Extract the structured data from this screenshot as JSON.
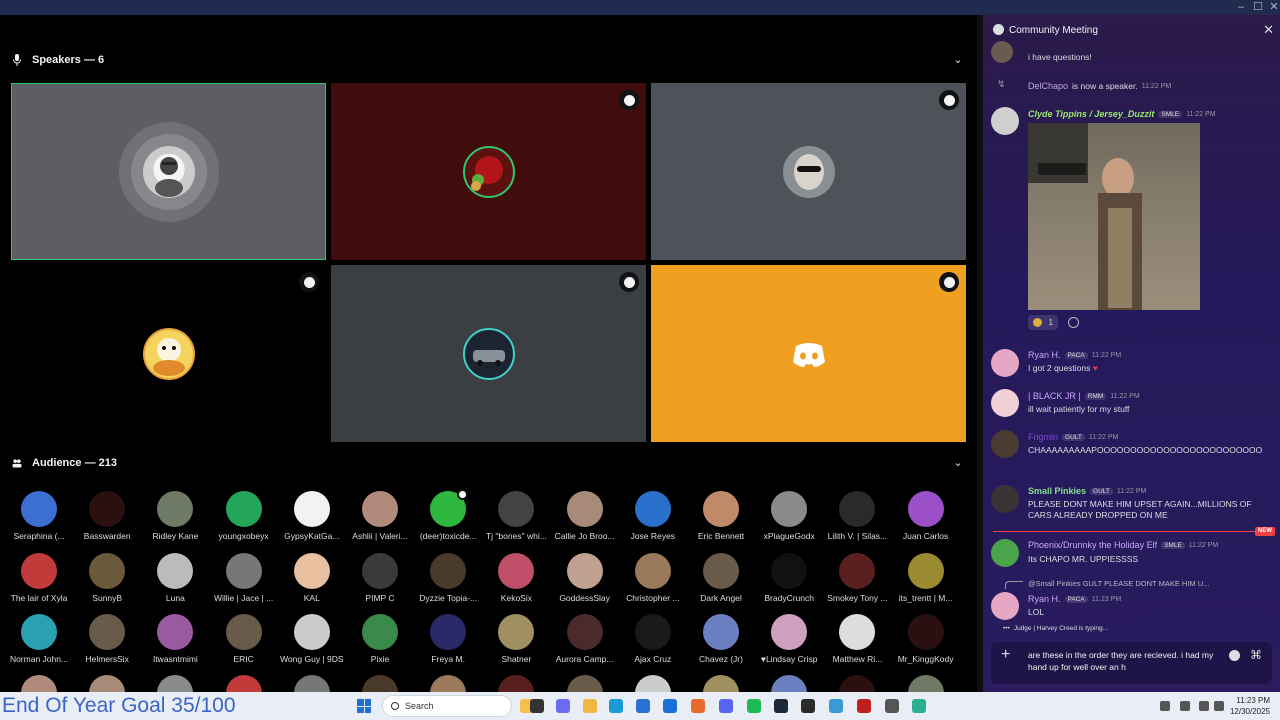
{
  "window": {
    "minimize": "–",
    "maximize": "☐",
    "close": "✕"
  },
  "speakers": {
    "heading": "Speakers — 6",
    "chevron": "⌄"
  },
  "audience": {
    "heading": "Audience — 213",
    "chevron": "⌄",
    "members": [
      [
        "Seraphina (...",
        "Basswarden",
        "Ridley Kane",
        "youngxobeyx",
        "GypsyKatGa...",
        "Ashlii | Valeri...",
        "(deer)toxicde...",
        "Tj \"bones\" whi...",
        "Callie Jo Broo...",
        "Jose Reyes",
        "Eric Bennett",
        "xPlagueGodx",
        "Lilith V. | Silas...",
        "Juan Carlos"
      ],
      [
        "The lair of Xyla",
        "SunnyB",
        "Luna",
        "Willie | Jace | ...",
        "KAL",
        "PIMP C",
        "Dyzzie Topia-...",
        "KekoSix",
        "GoddessSlay",
        "Christopher ...",
        "Dark Angel",
        "BradyCrunch",
        "Smokey Tony ...",
        "its_trentt | M..."
      ],
      [
        "Norman John...",
        "HelmersSix",
        "Itwasntmimi",
        "ERIC",
        "Wong Guy | 9DS",
        "Pixie",
        "Freya M.",
        "Shatner",
        "Aurora Camp...",
        "Ajax Cruz",
        "Chavez (Jr)",
        "♥Lindsay Crisp",
        "Matthew Ri...",
        "Mr_KinggKody"
      ]
    ]
  },
  "chat": {
    "title": "Community Meeting",
    "close": "✕",
    "messages": {
      "m0": {
        "body": "i have questions!"
      },
      "m1": {
        "user": "DelChapo",
        "text": "is now a speaker.",
        "time": "11:22 PM"
      },
      "m2": {
        "user": "Clyde Tippins / Jersey_Duzzit",
        "tag": "SMLE",
        "time": "11:22 PM",
        "reaction": "1"
      },
      "m3": {
        "user": "Ryan H.",
        "tag": "PACA",
        "time": "11:22 PM",
        "body": "I got 2 questions"
      },
      "m4": {
        "user": "| BLACK JR |",
        "tag": "RMM",
        "time": "11:22 PM",
        "body": "ill wait patiently for my stuff"
      },
      "m5": {
        "user": "Frigmin",
        "tag": "GULT",
        "time": "11:22 PM",
        "body": "CHAAAAAAAAAPOOOOOOOOOOOOOOOOOOOOOOOOO"
      },
      "m6": {
        "user": "Small Pinkies",
        "tag": "GULT",
        "time": "11:22 PM",
        "body": "PLEASE DONT MAKE HIM UPSET AGAIN...MILLIONS OF CARS ALREADY DROPPED ON ME"
      },
      "m7": {
        "user": "Phoenix/Drunnky the Holiday Elf",
        "tag": "SMLE",
        "time": "11:22 PM",
        "body": "Its CHAPO MR. UPPIESSSS",
        "new": "NEW"
      },
      "m8": {
        "reply": "@Small Pinkies  GULT  PLEASE DONT MAKE HIM U...",
        "user": "Ryan H.",
        "tag": "PACA",
        "time": "11:23 PM",
        "body": "LOL"
      }
    },
    "typing": "Judge | Harvey Creed is typing...",
    "composer": {
      "text": "are these in the order they are recieved. i had my hand up for well over an h"
    }
  },
  "taskbar": {
    "goal": "End Of Year Goal 35/100",
    "search": "Search",
    "time": "11:23 PM",
    "date": "12/30/2025"
  },
  "colors": {
    "speaking": "#23a55a",
    "discord_yellow": "#f0a020",
    "accent": "#5865f2"
  }
}
